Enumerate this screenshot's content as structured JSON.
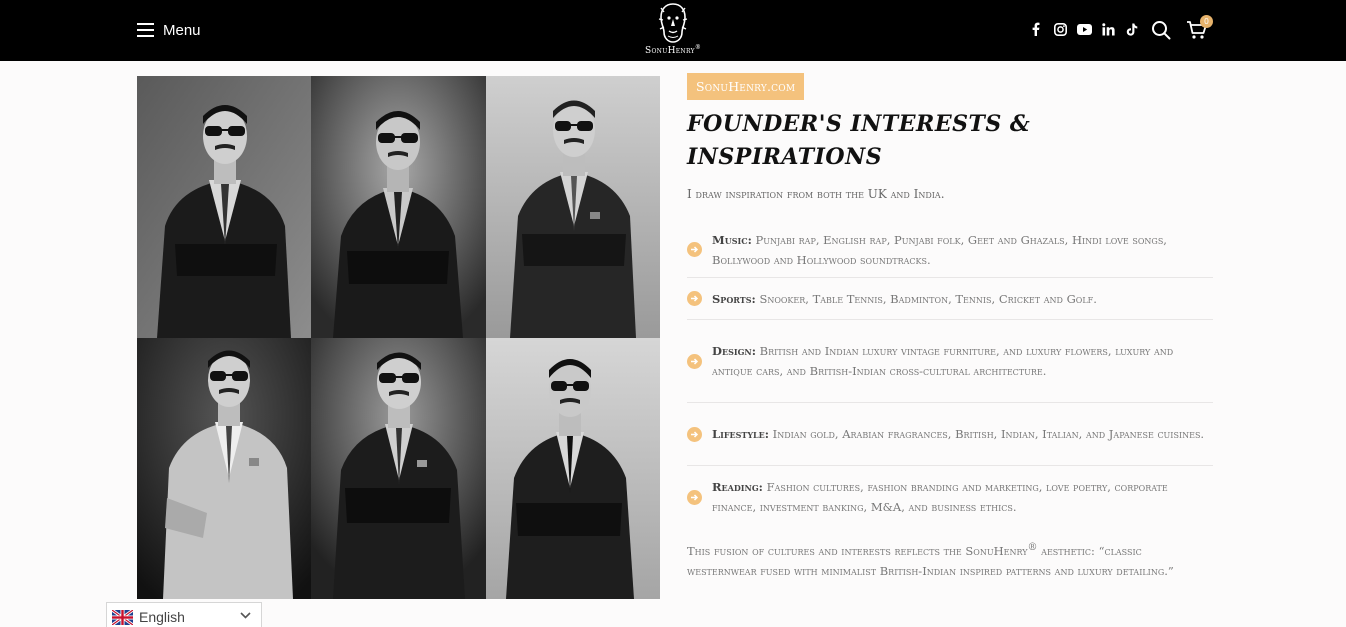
{
  "header": {
    "menu_label": "Menu",
    "logo_text": "SonuHenry",
    "logo_mark": "®",
    "social_icons": [
      "facebook-icon",
      "instagram-icon",
      "youtube-icon",
      "linkedin-icon",
      "tiktok-icon"
    ],
    "cart_count": "0"
  },
  "main": {
    "badge": "SonuHenry.com",
    "title": "Founder's Interests & Inspirations",
    "intro": "I draw inspiration from both the UK and India.",
    "interests": [
      {
        "label": "Music:",
        "text": "Punjabi rap, English rap, Punjabi folk, Geet and Ghazals, Hindi love songs, Bollywood and Hollywood soundtracks."
      },
      {
        "label": "Sports:",
        "text": "Snooker, Table Tennis, Badminton, Tennis, Cricket and Golf."
      },
      {
        "label": "Design:",
        "text": "British and Indian luxury vintage furniture, and luxury flowers, luxury and antique cars, and British-Indian cross-cultural architecture."
      },
      {
        "label": "Lifestyle:",
        "text": "Indian gold, Arabian fragrances, British, Indian, Italian, and Japanese cuisines."
      },
      {
        "label": "Reading:",
        "text": "Fashion cultures, fashion branding and marketing, love poetry, corporate finance, investment banking, M&A, and business ethics."
      }
    ],
    "outro_before": "This fusion of cultures and interests reflects the SonuHenry",
    "outro_reg": "®",
    "outro_after": " aesthetic: “classic westernwear fused with minimalist British-Indian inspired patterns and luxury detailing.”"
  },
  "language": {
    "selected": "English"
  },
  "colors": {
    "accent": "#f4c27d",
    "header_bg": "#000000",
    "title": "#111111"
  }
}
